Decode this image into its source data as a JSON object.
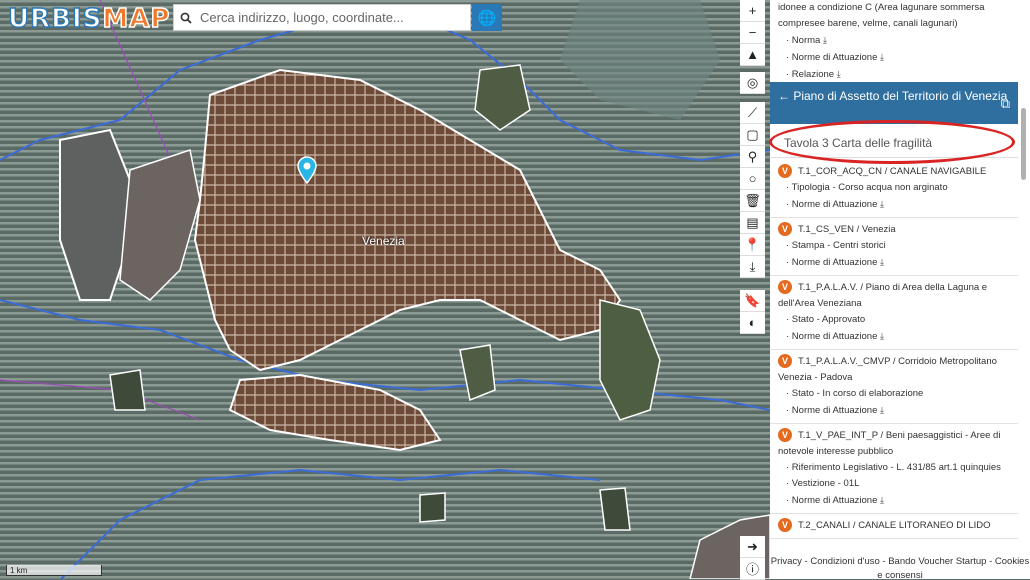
{
  "app": {
    "logo_a": "URBIS",
    "logo_b": "MAP"
  },
  "search": {
    "placeholder": "Cerca indirizzo, luogo, coordinate..."
  },
  "map": {
    "place_label": "Venezia",
    "scale_label": "1 km"
  },
  "panel": {
    "top_text": "idonee a condizione C (Area lagunare sommersa compresee barene, velme, canali lagunari)",
    "top_items": [
      "· Norma",
      "· Norme di Attuazione",
      "· Relazione"
    ],
    "header_title": "← Piano di Assetto del Territorio di Venezia",
    "subtitle": "Tavola 3 Carta delle fragilità",
    "badge": "V",
    "items": [
      {
        "title": "T.1_COR_ACQ_CN / CANALE NAVIGABILE",
        "lines": [
          "· Tipologia - Corso acqua non arginato",
          "· Norme di Attuazione"
        ]
      },
      {
        "title": "T.1_CS_VEN / Venezia",
        "lines": [
          "· Stampa - Centri storici",
          "· Norme di Attuazione"
        ]
      },
      {
        "title": "T.1_P.A.L.A.V. / Piano di Area della Laguna e dell'Area Veneziana",
        "lines": [
          "· Stato - Approvato",
          "· Norme di Attuazione"
        ]
      },
      {
        "title": "T.1_P.A.L.A.V._CMVP / Corridoio Metropolitano Venezia - Padova",
        "lines": [
          "· Stato - In corso di elaborazione",
          "· Norme di Attuazione"
        ]
      },
      {
        "title": "T.1_V_PAE_INT_P / Beni paesaggistici - Aree di notevole interesse pubblico",
        "lines": [
          "· Riferimento Legislativo - L. 431/85 art.1 quinquies",
          "· Vestizione - 01L",
          "· Norme di Attuazione"
        ]
      },
      {
        "title": "T.2_CANALI / CANALE LITORANEO DI LIDO",
        "lines": []
      }
    ],
    "footer": "Privacy - Condizioni d'uso - Bando Voucher Startup - Cookies e consensi"
  }
}
